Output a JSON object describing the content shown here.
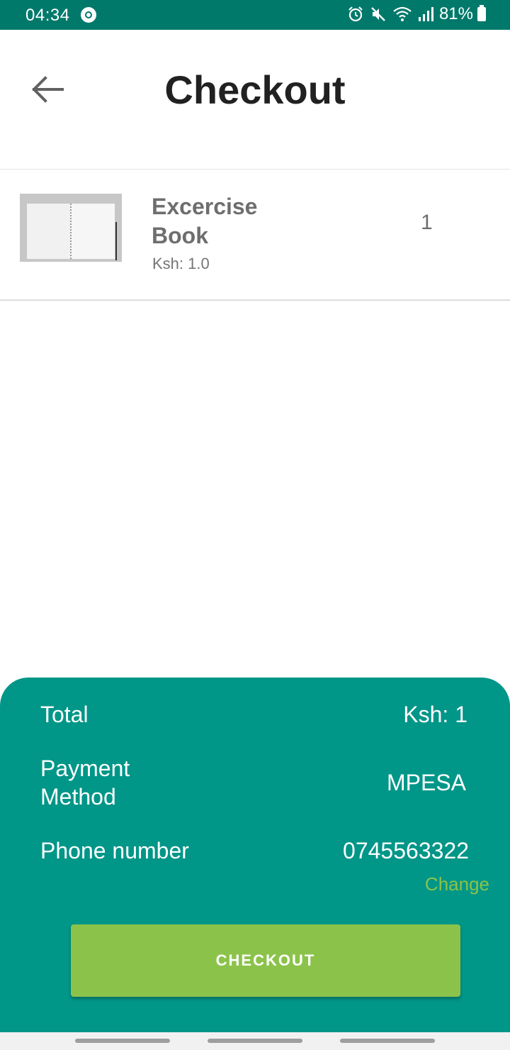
{
  "status_bar": {
    "time": "04:34",
    "battery": "81%",
    "icons": [
      "sync-icon",
      "alarm-icon",
      "mute-icon",
      "wifi-icon",
      "signal-icon",
      "battery-icon"
    ]
  },
  "header": {
    "title": "Checkout",
    "back_icon": "arrow-back-icon"
  },
  "cart": {
    "items": [
      {
        "name": "Excercise Book",
        "price": "Ksh: 1.0",
        "quantity": "1",
        "image": "notebook-image"
      }
    ]
  },
  "summary": {
    "total_label": "Total",
    "total_value": "Ksh: 1",
    "payment_label": "Payment Method",
    "payment_value": "MPESA",
    "phone_label": "Phone number",
    "phone_value": "0745563322",
    "change_label": "Change",
    "checkout_label": "CHECKOUT"
  },
  "colors": {
    "status_bar": "#00796b",
    "panel": "#009688",
    "accent": "#8bc34a",
    "title": "#212121",
    "item_text": "#6e6e6e"
  }
}
